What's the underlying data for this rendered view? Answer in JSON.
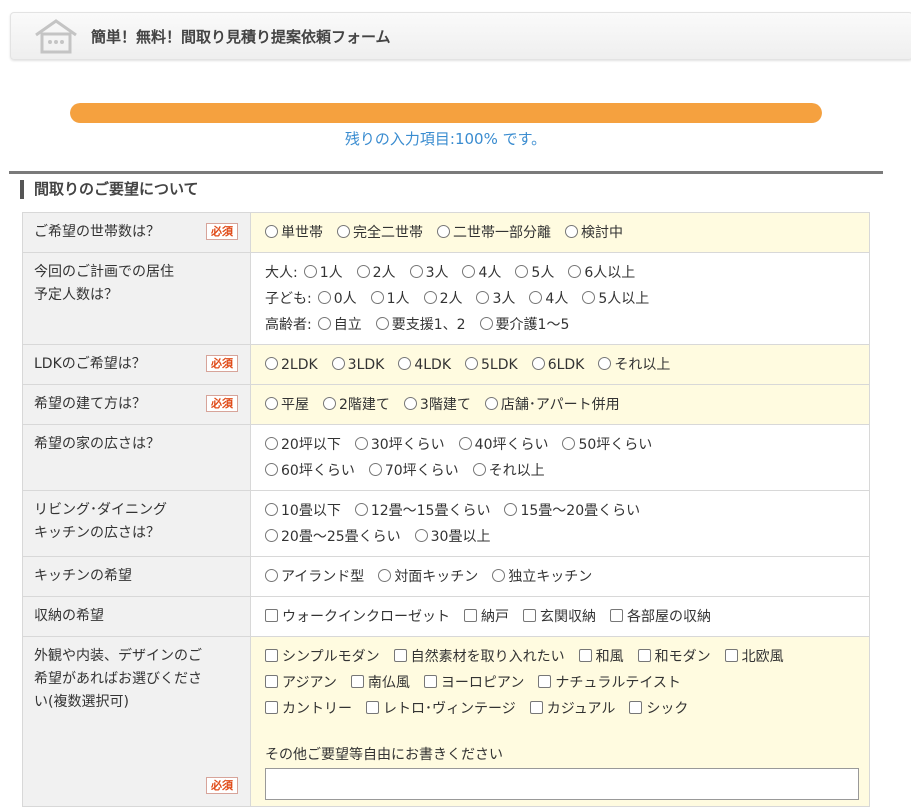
{
  "header": {
    "title": "簡単！無料！間取り見積り提案依頼フォーム"
  },
  "progress": {
    "percent": 100,
    "text": "残りの入力項目:100%  です。"
  },
  "section": {
    "title": "間取りのご要望について"
  },
  "required_label": "必須",
  "rows": [
    {
      "label": "ご希望の世帯数は？",
      "required": true,
      "lines": [
        {
          "type": "radio",
          "options": [
            "単世帯",
            "完全二世帯",
            "二世帯一部分離",
            "検討中"
          ]
        }
      ]
    },
    {
      "label": "今回のご計画での居住\n予定人数は？",
      "required": false,
      "lines": [
        {
          "type": "radio",
          "prefix": "大人:",
          "options": [
            "1人",
            "2人",
            "3人",
            "4人",
            "5人",
            "6人以上"
          ]
        },
        {
          "type": "radio",
          "prefix": "子ども:",
          "options": [
            "0人",
            "1人",
            "2人",
            "3人",
            "4人",
            "5人以上"
          ]
        },
        {
          "type": "radio",
          "prefix": "高齢者:",
          "options": [
            "自立",
            "要支援1、2",
            "要介護1〜5"
          ]
        }
      ]
    },
    {
      "label": "LDKのご希望は？",
      "required": true,
      "lines": [
        {
          "type": "radio",
          "options": [
            "2LDK",
            "3LDK",
            "4LDK",
            "5LDK",
            "6LDK",
            "それ以上"
          ]
        }
      ]
    },
    {
      "label": "希望の建て方は？",
      "required": true,
      "lines": [
        {
          "type": "radio",
          "options": [
            "平屋",
            "2階建て",
            "3階建て",
            "店舗･アパート併用"
          ]
        }
      ]
    },
    {
      "label": "希望の家の広さは？",
      "required": false,
      "lines": [
        {
          "type": "radio",
          "options": [
            "20坪以下",
            "30坪くらい",
            "40坪くらい",
            "50坪くらい"
          ]
        },
        {
          "type": "radio",
          "options": [
            "60坪くらい",
            "70坪くらい",
            "それ以上"
          ]
        }
      ]
    },
    {
      "label": "リビング･ダイニング\nキッチンの広さは？",
      "required": false,
      "lines": [
        {
          "type": "radio",
          "options": [
            "10畳以下",
            "12畳〜15畳くらい",
            "15畳〜20畳くらい"
          ]
        },
        {
          "type": "radio",
          "options": [
            "20畳〜25畳くらい",
            "30畳以上"
          ]
        }
      ]
    },
    {
      "label": "キッチンの希望",
      "required": false,
      "lines": [
        {
          "type": "radio",
          "options": [
            "アイランド型",
            "対面キッチン",
            "独立キッチン"
          ]
        }
      ]
    },
    {
      "label": "収納の希望",
      "required": false,
      "lines": [
        {
          "type": "check",
          "options": [
            "ウォークインクローゼット",
            "納戸",
            "玄関収納",
            "各部屋の収納"
          ]
        }
      ]
    },
    {
      "label": "外観や内装、デザインのご\n希望があればお選びくださ\nい(複数選択可)",
      "required": true,
      "lines": [
        {
          "type": "check",
          "options": [
            "シンプルモダン",
            "自然素材を取り入れたい",
            "和風",
            "和モダン",
            "北欧風"
          ]
        },
        {
          "type": "check",
          "options": [
            "アジアン",
            "南仏風",
            "ヨーロピアン",
            "ナチュラルテイスト"
          ]
        },
        {
          "type": "check",
          "options": [
            "カントリー",
            "レトロ･ヴィンテージ",
            "カジュアル",
            "シック"
          ]
        }
      ],
      "free_text_label": "その他ご要望等自由にお書きください"
    }
  ]
}
